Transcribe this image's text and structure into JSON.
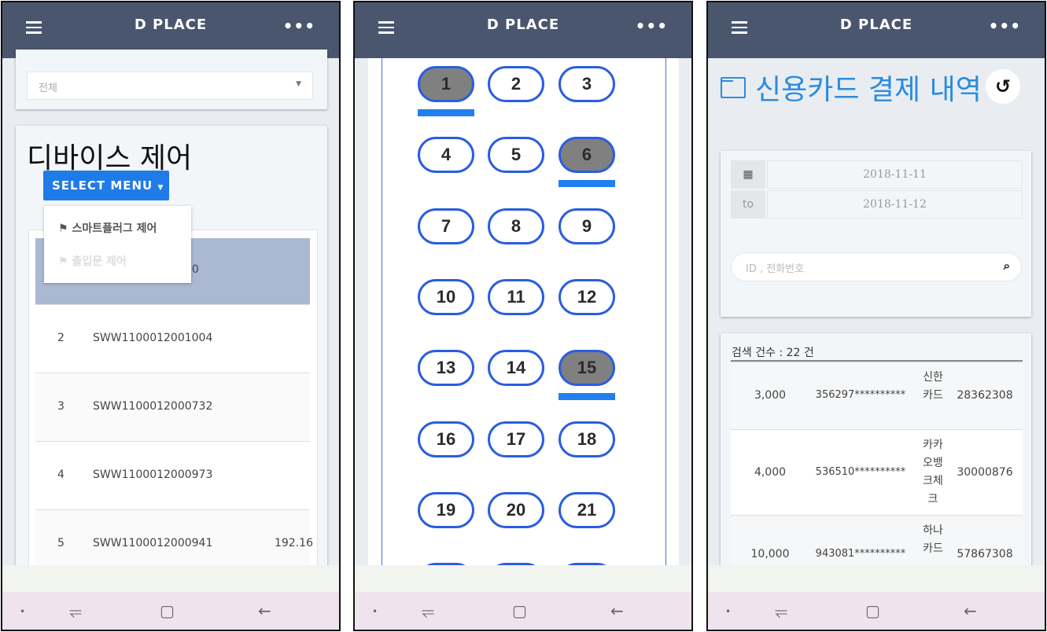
{
  "app": {
    "title": "D PLACE",
    "menu_icon": "hamburger-icon",
    "more_icon": "more-icon"
  },
  "nav": {
    "dot": "•",
    "recent": "⥫",
    "home": "▢",
    "back": "←"
  },
  "screen1": {
    "filter": {
      "value": "전체"
    },
    "title": "디바이스 제어",
    "select_menu": "SELECT MENU",
    "dropdown": [
      "스마트플러그 제어",
      "출입문 제어"
    ],
    "header_partial": "40",
    "rows": [
      {
        "no": "2",
        "id": "SWW1100012001004",
        "ip": ""
      },
      {
        "no": "3",
        "id": "SWW1100012000732",
        "ip": ""
      },
      {
        "no": "4",
        "id": "SWW1100012000973",
        "ip": ""
      },
      {
        "no": "5",
        "id": "SWW1100012000941",
        "ip": "192.16"
      }
    ]
  },
  "screen2": {
    "buttons": [
      "1",
      "2",
      "3",
      "4",
      "5",
      "6",
      "7",
      "8",
      "9",
      "10",
      "11",
      "12",
      "13",
      "14",
      "15",
      "16",
      "17",
      "18",
      "19",
      "20",
      "21"
    ],
    "selected": [
      "1",
      "6",
      "15"
    ]
  },
  "screen3": {
    "title": "신용카드 결제 내역",
    "date_from": "2018-11-11",
    "to_label": "to",
    "date_to": "2018-11-12",
    "search_placeholder": "ID , 전화번호",
    "count": "검색 건수 : 22 건",
    "rows": [
      {
        "amount": "3,000",
        "card": "356297**********",
        "company": "신한카드",
        "approval": "28362308"
      },
      {
        "amount": "4,000",
        "card": "536510**********",
        "company": "카카오뱅크체크",
        "approval": "30000876"
      },
      {
        "amount": "10,000",
        "card": "943081**********",
        "company": "하나카드",
        "approval": "57867308"
      }
    ]
  },
  "colors": {
    "header": "#4a566e",
    "accent": "#1e7be8",
    "title_blue": "#2a8be0",
    "selected_fill": "#808080"
  }
}
